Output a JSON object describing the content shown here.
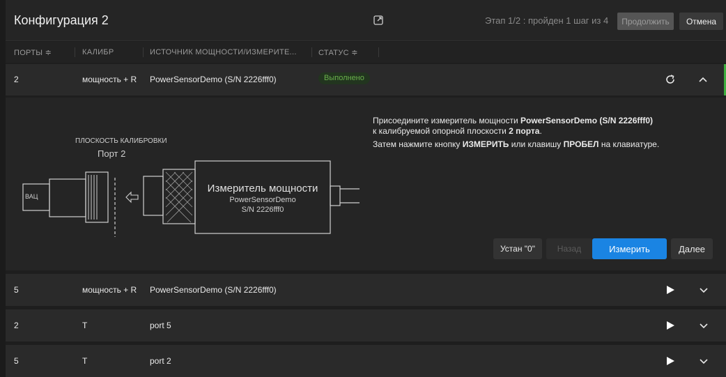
{
  "header": {
    "title": "Конфигурация 2",
    "stage_text": "Этап 1/2 : пройден 1 шаг из 4",
    "continue_label": "Продолжить",
    "cancel_label": "Отмена"
  },
  "columns": {
    "ports": "ПОРТЫ ≑",
    "calib": "КАЛИБР",
    "source": "ИСТОЧНИК МОЩНОСТИ/ИЗМЕРИТЕ...",
    "status": "СТАТУС ≑"
  },
  "rows": [
    {
      "port": "2",
      "calib": "мощность + R",
      "source": "PowerSensorDemo (S/N 2226fff0)",
      "status": "Выполнено"
    },
    {
      "port": "5",
      "calib": "мощность + R",
      "source": "PowerSensorDemo (S/N 2226fff0)",
      "status": ""
    },
    {
      "port": "2",
      "calib": "T",
      "source": "port 5",
      "status": ""
    },
    {
      "port": "5",
      "calib": "T",
      "source": "port 2",
      "status": ""
    }
  ],
  "diagram": {
    "plane_label": "ПЛОСКОСТЬ КАЛИБРОВКИ",
    "port_label": "Порт 2",
    "vna_label": "ВАЦ",
    "meter_title": "Измеритель мощности",
    "meter_model": "PowerSensorDemo",
    "meter_sn": "S/N 2226fff0"
  },
  "instructions": {
    "line1_a": "Присоедините измеритель мощности ",
    "line1_b": "PowerSensorDemo (S/N 2226fff0)",
    "line2_a": "к калибруемой опорной плоскости ",
    "line2_b": "2 порта",
    "line2_c": ".",
    "line3_a": "Затем нажмите кнопку ",
    "line3_b": "ИЗМЕРИТЬ",
    "line3_c": " или клавишу ",
    "line3_d": "ПРОБЕЛ",
    "line3_e": " на клавиатуре."
  },
  "actions": {
    "zero_label": "Устан \"0\"",
    "back_label": "Назад",
    "measure_label": "Измерить",
    "next_label": "Далее"
  },
  "colors": {
    "accent": "#1a84e3",
    "success": "#6ab04c",
    "success_bar": "#3fae3f"
  },
  "icons": {
    "external": "external-link-icon",
    "refresh": "refresh-icon",
    "collapse": "chevron-up-icon",
    "play": "play-icon",
    "expand": "chevron-down-icon"
  }
}
